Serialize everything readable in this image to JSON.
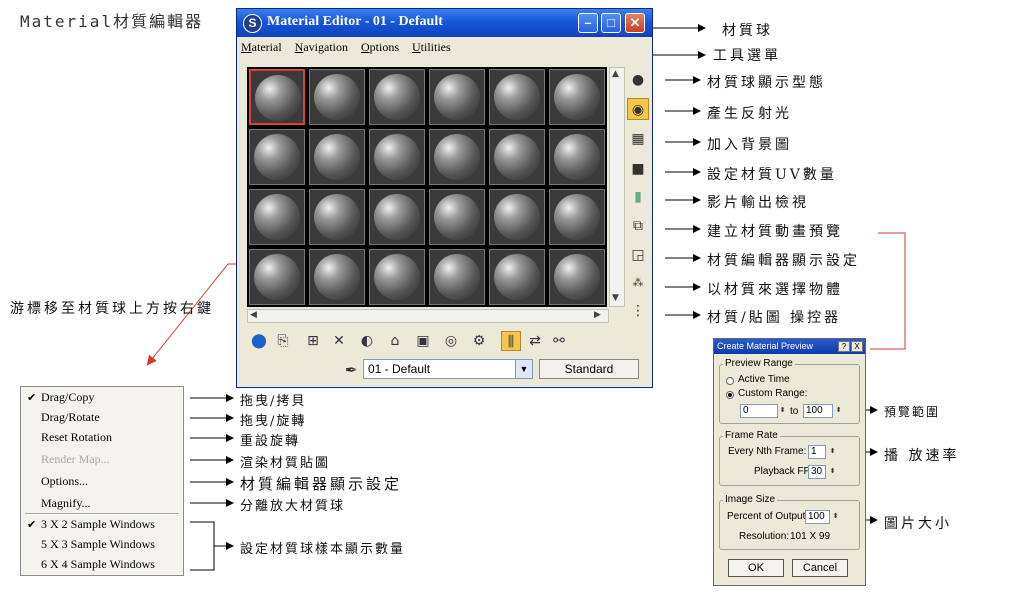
{
  "heading": "Material材質編輯器",
  "editor": {
    "title": "Material Editor - 01 - Default",
    "app_icon": "3ds-max-icon",
    "menu": [
      "Material",
      "Navigation",
      "Options",
      "Utilities"
    ],
    "sample_grid": {
      "rows": 4,
      "cols": 6,
      "selected_index": 0
    },
    "side_tools": [
      "sample-type-icon",
      "backlight-icon",
      "background-icon",
      "sample-uv-tiling-icon",
      "video-color-check-icon",
      "make-preview-icon",
      "options-icon",
      "select-by-material-icon",
      "material-map-navigator-icon"
    ],
    "bottom_tools": [
      "get-material-icon",
      "put-to-scene-icon",
      "assign-to-selection-icon",
      "reset-map-icon",
      "make-unique-icon",
      "put-to-library-icon",
      "material-id-icon",
      "show-map-icon",
      "show-end-result-icon",
      "go-to-parent-icon",
      "go-forward-icon"
    ],
    "material_name": "01 - Default",
    "type_button": "Standard"
  },
  "annotations": {
    "sample_ball": "材質球",
    "menu_bar": "工具選單",
    "sample_type": "材質球顯示型態",
    "backlight": "產生反射光",
    "background": "加入背景圖",
    "uv_tiling": "設定材質UV數量",
    "video_check": "影片輸出檢視",
    "make_preview": "建立材質動畫預覽",
    "options": "材質編輯器顯示設定",
    "select_by_material": "以材質來選擇物體",
    "navigator": "材質/貼圖 操控器",
    "right_click": "游標移至材質球上方按右鍵",
    "preview_range": "預覽範圍",
    "frame_rate": "播 放速率",
    "image_size": "圖片大小",
    "sample_windows": "設定材質球樣本顯示數量"
  },
  "context_menu": {
    "items": [
      {
        "label": "Drag/Copy",
        "checked": true,
        "disabled": false,
        "note": "拖曳/拷貝"
      },
      {
        "label": "Drag/Rotate",
        "checked": false,
        "disabled": false,
        "note": "拖曳/旋轉"
      },
      {
        "label": "Reset Rotation",
        "checked": false,
        "disabled": false,
        "note": "重設旋轉"
      },
      {
        "label": "Render Map...",
        "checked": false,
        "disabled": true,
        "note": "渲染材質貼圖"
      },
      {
        "label": "Options...",
        "checked": false,
        "disabled": false,
        "note": "材質編輯器顯示設定"
      },
      {
        "label": "Magnify...",
        "checked": false,
        "disabled": false,
        "note": "分離放大材質球"
      }
    ],
    "sample_windows": [
      {
        "label": "3 X 2 Sample Windows",
        "checked": true
      },
      {
        "label": "5 X 3 Sample Windows",
        "checked": false
      },
      {
        "label": "6 X 4 Sample Windows",
        "checked": false
      }
    ]
  },
  "preview_dialog": {
    "title": "Create Material Preview",
    "help_btn": "?",
    "close_btn": "X",
    "preview_range": {
      "label": "Preview Range",
      "active_time": "Active Time",
      "custom_range": "Custom Range:",
      "selected": "Custom Range:",
      "from": "0",
      "to_label": "to",
      "to": "100"
    },
    "frame_rate": {
      "label": "Frame Rate",
      "nth_label": "Every Nth Frame:",
      "nth": "1",
      "fps_label": "Playback FPS:",
      "fps": "30"
    },
    "image_size": {
      "label": "Image Size",
      "percent_label": "Percent of Output:",
      "percent": "100",
      "resolution_label": "Resolution:",
      "resolution": "101 X 99"
    },
    "ok": "OK",
    "cancel": "Cancel"
  }
}
